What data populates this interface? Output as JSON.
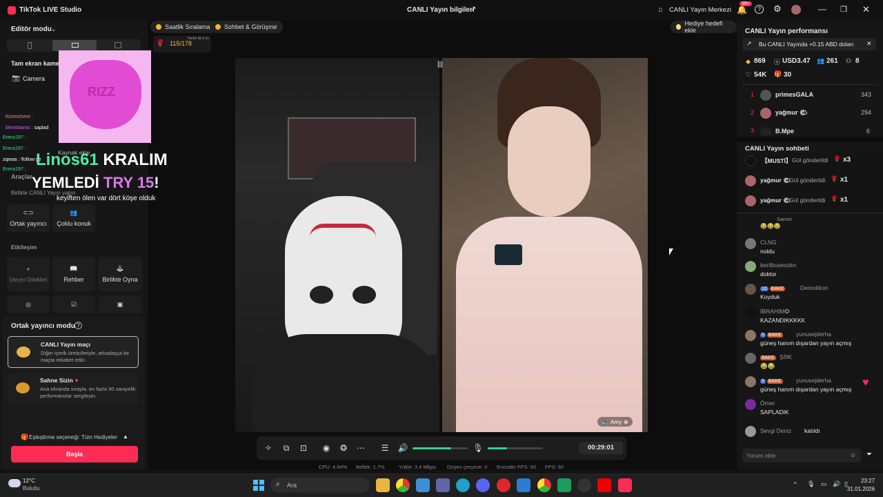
{
  "titlebar": {
    "app_title": "TikTok LIVE Studio",
    "center_title": "CANLI Yayın bilgileri",
    "center_button": "CANLI Yayın Merkezi",
    "notif_count": "99+"
  },
  "left": {
    "editor_mode": "Editör modu",
    "fullscreen": "Tam ekran kamera",
    "camera": "Camera",
    "add_source": "Kaynak ekle",
    "tools": "Araçlar",
    "together": "Birlikte CANLI Yayın yapın",
    "cohost": "Ortak yayıncı",
    "multi_guest": "Çoklu konuk",
    "interaction": "Etkileşim",
    "viewer_wishes": "İzleyici Dilekleri",
    "guide": "Rehber",
    "play_together": "Birlikte Oyna",
    "cohost_mode": "Ortak yayıncı modu",
    "match_title": "CANLI Yayın maçı",
    "match_desc": "Diğer içerik üreticileriyle, arkadaşça bir maçta rekabet edin.",
    "stage_title": "Sahne Sizin",
    "stage_desc": "Ana ekranda sırayla, en fazla 90 saniyelik performanslar sergileyin.",
    "matching_pref": "Eşleştirme seçeneği: Tüm Hediyeler",
    "start_button": "Başla"
  },
  "overlay": {
    "rizz": "RIZZ",
    "chat_lines": [
      {
        "user": "frizexishere :",
        "text": ""
      },
      {
        "user": "bitmisbaros :",
        "text": "saplad"
      },
      {
        "user": "Erenx297 :",
        "text": ""
      },
      {
        "user": "Erenx297 :",
        "text": ""
      },
      {
        "user": "zqewa :",
        "text": "!follow ge"
      },
      {
        "user": "Erenx297 :",
        "text": ""
      }
    ],
    "big_line1_user": "Linos61",
    "big_line1_rest": "KRALIM",
    "big_line2_a": "YEMLEDİ",
    "big_line2_b": "TRY 15",
    "big_line2_c": "!",
    "sub_line": "keyiften ölen var dört köşe olduk",
    "gift_progress": "115/178",
    "gift_timer": "Hedef dk 3 sn"
  },
  "center": {
    "pill_hourly": "Saatlik Sıralama",
    "pill_chat": "Sohbet & Görüşme",
    "pill_gift_goal": "Hediye hedefi ekle",
    "timer": "00:29:01",
    "guest_name": "Amy",
    "stats": {
      "cpu": "CPU: 4.94%",
      "memory": "Bellek: 1.7%",
      "upload": "Yükle: 3.4 Mbps",
      "dropped": "Düşen çerçeve: 0",
      "encoder": "Encoder FPS: 60",
      "fps": "FPS: 60"
    },
    "volume_level": 0.7,
    "mic_level": 0.35
  },
  "right": {
    "perf_title": "CANLI Yayın performansı",
    "earn_banner": "Bu CANLI Yayında +0.15 ABD doları",
    "stat_diamonds": "869",
    "stat_usd": "USD3.47",
    "stat_viewers": "261",
    "stat_new": "8",
    "stat_likes": "54K",
    "stat_gifts": "30",
    "leaders": [
      {
        "rank": "1",
        "name": "primesGALA",
        "score": "343"
      },
      {
        "rank": "2",
        "name": "yağmur 🌤",
        "score": "294"
      },
      {
        "rank": "3",
        "name": "B.Mpe",
        "score": "6"
      }
    ],
    "chat_title": "CANLI Yayın sohbeti",
    "gift_rows": [
      {
        "user": "【MUSTİ】",
        "text": "Gül gönderildi",
        "count": "x3"
      },
      {
        "user": "yağmur 🌤",
        "text": "Gül gönderildi",
        "count": "x1"
      },
      {
        "user": "yağmur 🌤",
        "text": "Gül gönderildi",
        "count": "x1"
      }
    ],
    "messages": [
      {
        "user": "Samet",
        "badge": "",
        "text": "😂😂😂"
      },
      {
        "user": "CLNG",
        "badge": "",
        "text": "noldu"
      },
      {
        "user": "berilbuseozkn",
        "badge": "",
        "text": "doktor"
      },
      {
        "user": "Demolition",
        "badge": "10",
        "text": "Koyduk"
      },
      {
        "user": "İBRAHİM✪",
        "badge": "",
        "text": "KAZANDIKKKKK"
      },
      {
        "user": "yunusejderha",
        "badge": "5",
        "text": "güneş hanım dışardan yayın açmış"
      },
      {
        "user": "ŞƏK",
        "badge": "",
        "text": "😂😂"
      },
      {
        "user": "yunusejderha",
        "badge": "5",
        "text": "güneş hanım dışardan yayın açmış"
      },
      {
        "user": "Ömer",
        "badge": "",
        "text": "SAPLADIK"
      },
      {
        "user": "Sevgi Deniz",
        "badge": "",
        "text": "katıldı"
      }
    ],
    "comment_placeholder": "Yorum ekle"
  },
  "taskbar": {
    "weather_temp": "12°C",
    "weather_desc": "Bulutlu",
    "search": "Ara",
    "time": "23:27",
    "date": "31.01.2026"
  }
}
